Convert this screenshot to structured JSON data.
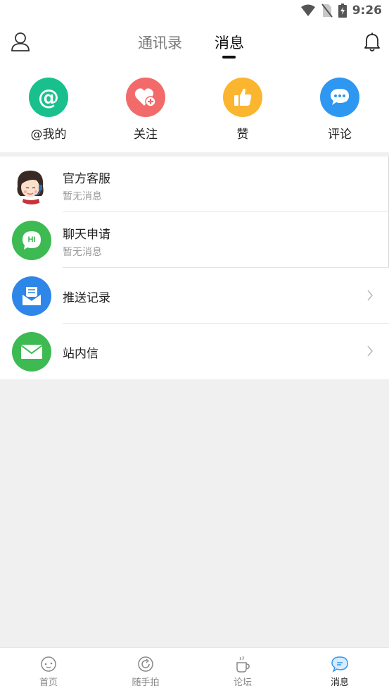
{
  "status_bar": {
    "time": "9:26"
  },
  "header": {
    "tabs": [
      {
        "label": "通讯录",
        "active": false
      },
      {
        "label": "消息",
        "active": true
      }
    ]
  },
  "quick_actions": [
    {
      "label": "@我的",
      "icon": "at-icon",
      "color": "#19c08e"
    },
    {
      "label": "关注",
      "icon": "heart-plus-icon",
      "color": "#f36a6a"
    },
    {
      "label": "赞",
      "icon": "thumbs-up-icon",
      "color": "#fbb52f"
    },
    {
      "label": "评论",
      "icon": "comment-icon",
      "color": "#2e97f2"
    }
  ],
  "messages": [
    {
      "title": "官方客服",
      "subtitle": "暂无消息",
      "icon": "customer-service-avatar"
    },
    {
      "title": "聊天申请",
      "subtitle": "暂无消息",
      "icon": "hi-chat-icon",
      "color": "#3dba52",
      "icon_text": "HI"
    },
    {
      "title": "推送记录",
      "icon": "push-envelope-icon",
      "color": "#2e86e8"
    },
    {
      "title": "站内信",
      "icon": "mail-icon",
      "color": "#3dba52"
    }
  ],
  "bottom_nav": [
    {
      "label": "首页",
      "icon": "home-face-icon",
      "active": false
    },
    {
      "label": "随手拍",
      "icon": "camera-refresh-icon",
      "active": false
    },
    {
      "label": "论坛",
      "icon": "coffee-cup-icon",
      "active": false
    },
    {
      "label": "消息",
      "icon": "chat-bubble-icon",
      "active": true
    }
  ],
  "colors": {
    "accent": "#2e97f2",
    "background": "#f0f0f0"
  }
}
